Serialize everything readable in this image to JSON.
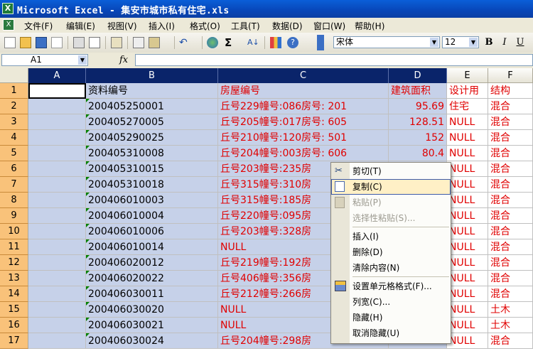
{
  "window": {
    "title": "Microsoft Excel - 集安市城市私有住宅.xls"
  },
  "menu": [
    "文件(F)",
    "编辑(E)",
    "视图(V)",
    "插入(I)",
    "格式(O)",
    "工具(T)",
    "数据(D)",
    "窗口(W)",
    "帮助(H)"
  ],
  "toolbar": {
    "font_name": "宋体",
    "font_size": "12",
    "bold": "B",
    "italic": "I",
    "underline": "U"
  },
  "formula_bar": {
    "name_box": "A1",
    "fx": "fx",
    "content": ""
  },
  "columns": [
    "A",
    "B",
    "C",
    "D",
    "E",
    "F"
  ],
  "rows": [
    {
      "n": "1",
      "b": "资料编号",
      "c": "房屋编号",
      "d": "建筑面积",
      "e": "设计用",
      "f": "结构"
    },
    {
      "n": "2",
      "b": "200405250001",
      "c": "丘号229幢号:086房号: 201",
      "d": "95.69",
      "e": "住宅",
      "f": "混合"
    },
    {
      "n": "3",
      "b": "200405270005",
      "c": "丘号205幢号:017房号: 605",
      "d": "128.51",
      "e": "NULL",
      "f": "混合"
    },
    {
      "n": "4",
      "b": "200405290025",
      "c": "丘号210幢号:120房号: 501",
      "d": "152",
      "e": "NULL",
      "f": "混合"
    },
    {
      "n": "5",
      "b": "200405310008",
      "c": "丘号204幢号:003房号: 606",
      "d": "80.4",
      "e": "NULL",
      "f": "混合"
    },
    {
      "n": "6",
      "b": "200405310015",
      "c": "丘号203幢号:235房",
      "d": "",
      "e": "NULL",
      "f": "混合"
    },
    {
      "n": "7",
      "b": "200405310018",
      "c": "丘号315幢号:310房",
      "d": "",
      "e": "NULL",
      "f": "混合"
    },
    {
      "n": "8",
      "b": "200406010003",
      "c": "丘号315幢号:185房",
      "d": "",
      "e": "NULL",
      "f": "混合"
    },
    {
      "n": "9",
      "b": "200406010004",
      "c": "丘号220幢号:095房",
      "d": "",
      "e": "NULL",
      "f": "混合"
    },
    {
      "n": "10",
      "b": "200406010006",
      "c": "丘号203幢号:328房",
      "d": "",
      "e": "NULL",
      "f": "混合"
    },
    {
      "n": "11",
      "b": "200406010014",
      "c": "NULL",
      "d": "",
      "e": "NULL",
      "f": "混合"
    },
    {
      "n": "12",
      "b": "200406020012",
      "c": "丘号219幢号:192房",
      "d": "",
      "e": "NULL",
      "f": "混合"
    },
    {
      "n": "13",
      "b": "200406020022",
      "c": "丘号406幢号:356房",
      "d": "",
      "e": "NULL",
      "f": "混合"
    },
    {
      "n": "14",
      "b": "200406030011",
      "c": "丘号212幢号:266房",
      "d": "",
      "e": "NULL",
      "f": "混合"
    },
    {
      "n": "15",
      "b": "200406030020",
      "c": "NULL",
      "d": "",
      "e": "NULL",
      "f": "土木"
    },
    {
      "n": "16",
      "b": "200406030021",
      "c": "NULL",
      "d": "",
      "e": "NULL",
      "f": "土木"
    },
    {
      "n": "17",
      "b": "200406030024",
      "c": "丘号204幢号:298房",
      "d": "",
      "e": "NULL",
      "f": "混合"
    }
  ],
  "context_menu": [
    {
      "label": "剪切(T)",
      "icon": "cut-icon",
      "state": "normal"
    },
    {
      "label": "复制(C)",
      "icon": "copy-icon",
      "state": "highlighted"
    },
    {
      "label": "粘贴(P)",
      "icon": "paste-icon",
      "state": "disabled"
    },
    {
      "label": "选择性粘贴(S)...",
      "icon": "",
      "state": "disabled"
    },
    {
      "label": "插入(I)",
      "icon": "",
      "state": "normal"
    },
    {
      "label": "删除(D)",
      "icon": "",
      "state": "normal"
    },
    {
      "label": "清除内容(N)",
      "icon": "",
      "state": "normal"
    },
    {
      "label": "设置单元格格式(F)...",
      "icon": "format-cells-icon",
      "state": "normal"
    },
    {
      "label": "列宽(C)...",
      "icon": "",
      "state": "normal"
    },
    {
      "label": "隐藏(H)",
      "icon": "",
      "state": "normal"
    },
    {
      "label": "取消隐藏(U)",
      "icon": "",
      "state": "normal"
    }
  ],
  "colors": {
    "selection": "#c6d1e9",
    "row_header": "#f9c27a",
    "text_red": "#e00000",
    "menu_highlight": "#fff0c6"
  }
}
